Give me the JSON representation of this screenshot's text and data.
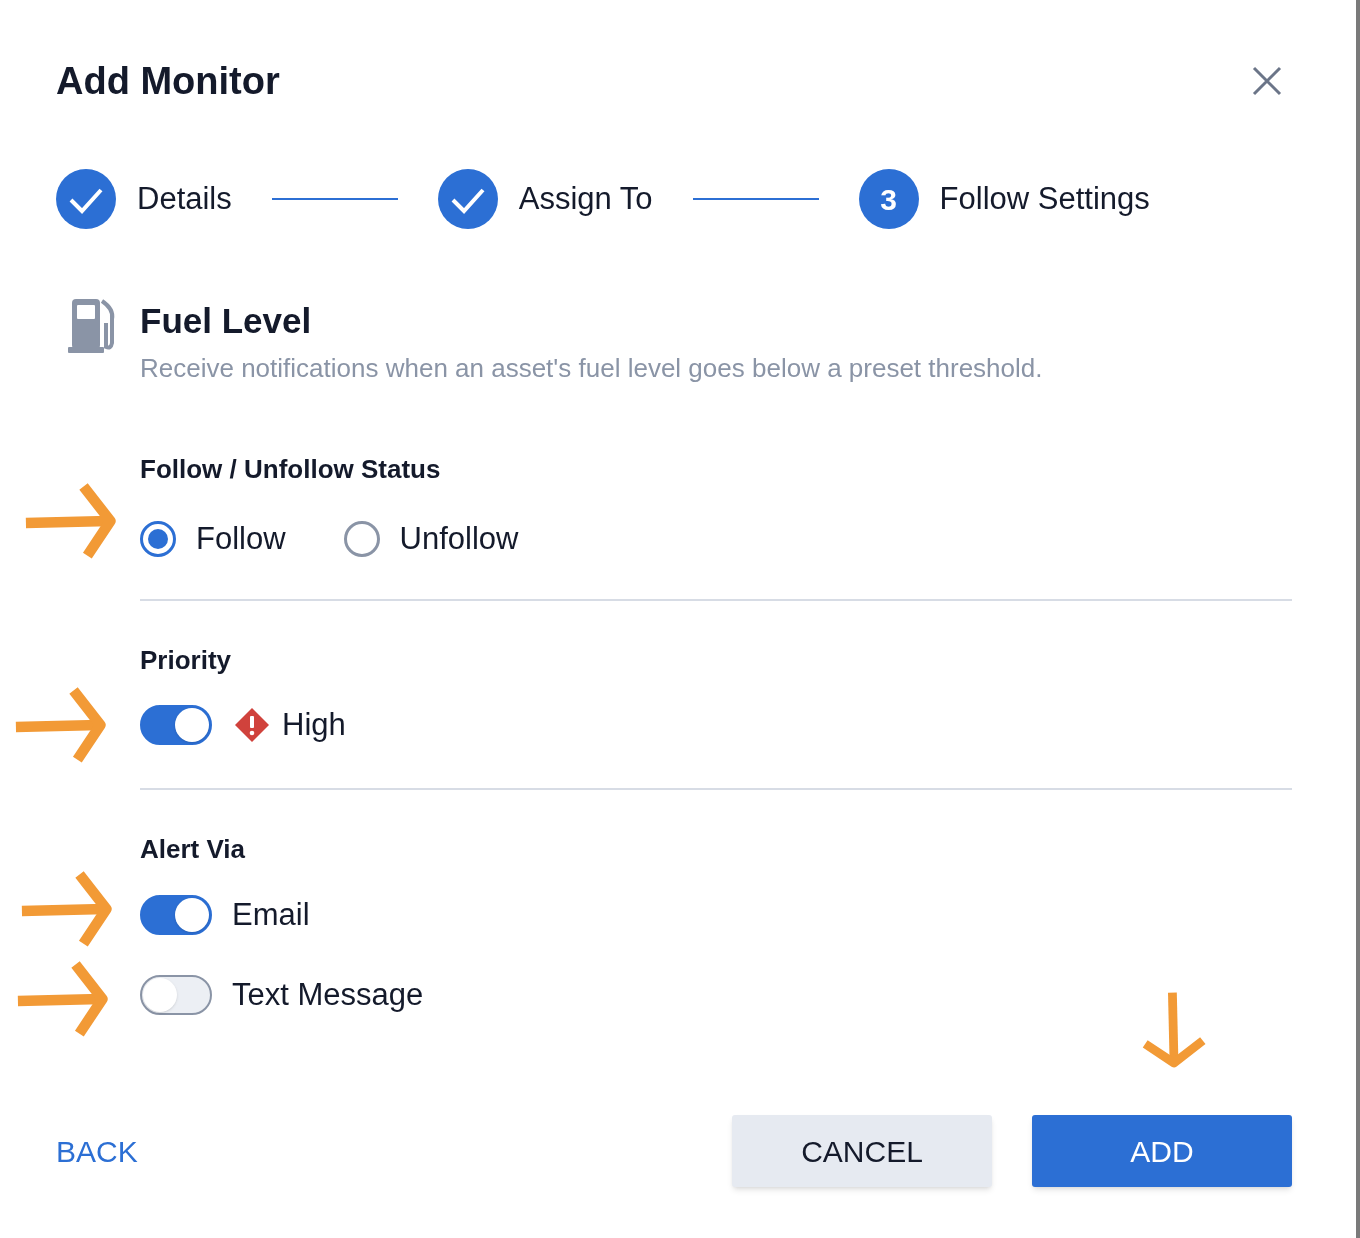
{
  "dialog": {
    "title": "Add Monitor"
  },
  "steps": [
    {
      "label": "Details",
      "kind": "done"
    },
    {
      "label": "Assign To",
      "kind": "done"
    },
    {
      "label": "Follow Settings",
      "kind": "current",
      "number": "3"
    }
  ],
  "monitor": {
    "title": "Fuel Level",
    "description": "Receive notifications when an asset's fuel level goes below a preset threshold."
  },
  "follow_status": {
    "heading": "Follow / Unfollow Status",
    "options": [
      {
        "label": "Follow",
        "selected": true
      },
      {
        "label": "Unfollow",
        "selected": false
      }
    ]
  },
  "priority": {
    "heading": "Priority",
    "on": true,
    "label": "High"
  },
  "alert_via": {
    "heading": "Alert Via",
    "channels": [
      {
        "label": "Email",
        "on": true
      },
      {
        "label": "Text Message",
        "on": false
      }
    ]
  },
  "buttons": {
    "back": "BACK",
    "cancel": "CANCEL",
    "add": "ADD"
  }
}
